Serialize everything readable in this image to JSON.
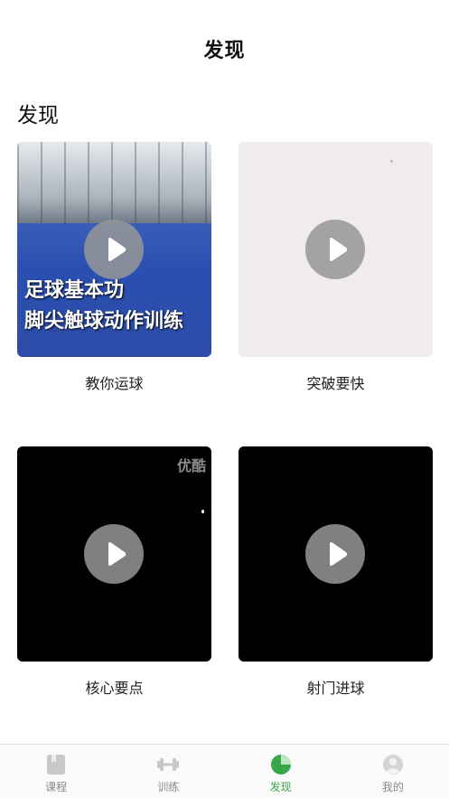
{
  "header": {
    "title": "发现"
  },
  "section": {
    "title": "发现"
  },
  "videos": [
    {
      "label": "教你运球",
      "caption_line1": "足球基本功",
      "caption_line2": "脚尖触球动作训练"
    },
    {
      "label": "突破要快"
    },
    {
      "label": "核心要点",
      "watermark": "优酷"
    },
    {
      "label": "射门进球"
    }
  ],
  "tabbar": {
    "tabs": [
      {
        "label": "课程",
        "icon": "book-icon"
      },
      {
        "label": "训练",
        "icon": "dumbbell-icon"
      },
      {
        "label": "发现",
        "icon": "pie-chart-icon",
        "active": true
      },
      {
        "label": "我的",
        "icon": "user-icon"
      }
    ],
    "active_color": "#3aa64a",
    "inactive_color": "#8a8a8a"
  }
}
